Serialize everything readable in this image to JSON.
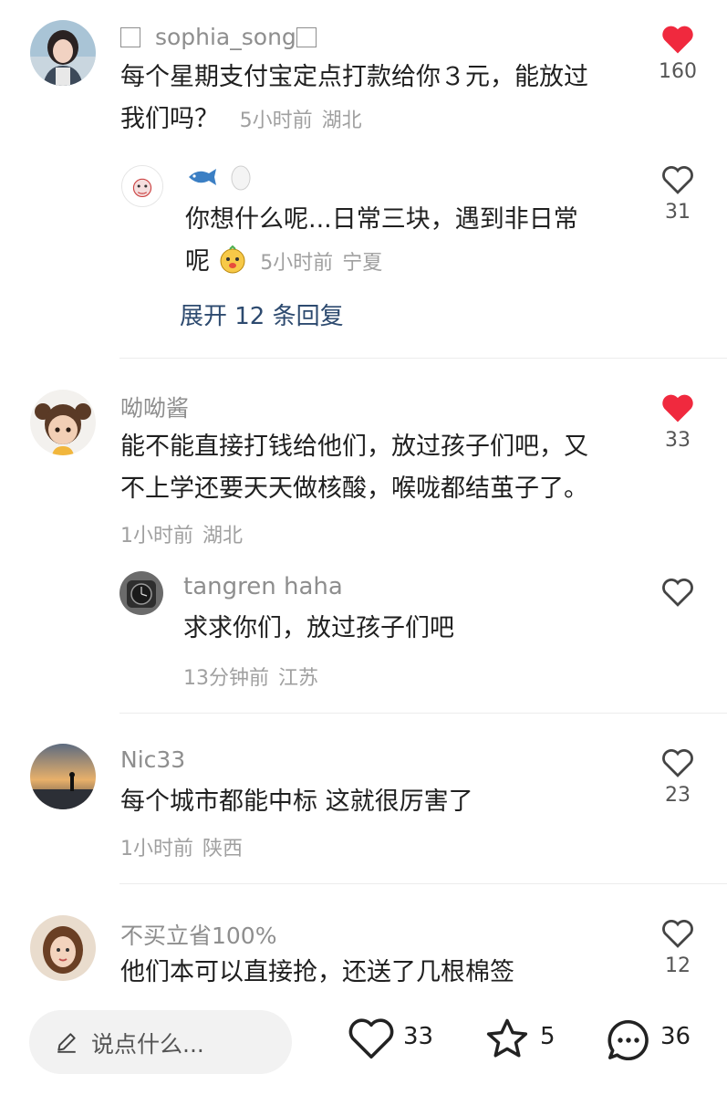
{
  "comments": [
    {
      "username": "sophia_song",
      "text_line1": "每个星期支付宝定点打款给你３元，能放过",
      "text_line2": "我们吗？",
      "time": "5小时前",
      "location": "湖北",
      "likes": "160",
      "liked": true,
      "reply": {
        "username": "🐟🥚",
        "text_line1": "你想什么呢...日常三块，遇到非日常",
        "text_line2": "呢",
        "time": "5小时前",
        "location": "宁夏",
        "likes": "31"
      },
      "expand_label": "展开 12 条回复"
    },
    {
      "username": "呦呦酱",
      "text_line1": "能不能直接打钱给他们，放过孩子们吧，又",
      "text_line2": "不上学还要天天做核酸，喉咙都结茧子了。",
      "time": "1小时前",
      "location": "湖北",
      "likes": "33",
      "liked": true,
      "reply": {
        "username": "tangren haha",
        "text": "求求你们，放过孩子们吧",
        "time": "13分钟前",
        "location": "江苏"
      }
    },
    {
      "username": "Nic33",
      "text": "每个城市都能中标 这就很厉害了",
      "time": "1小时前",
      "location": "陕西",
      "likes": "23"
    },
    {
      "username": "不买立省100%",
      "text": "他们本可以直接抢，还送了几根棉签",
      "likes": "12"
    }
  ],
  "bottom_bar": {
    "input_placeholder": "说点什么...",
    "likes": "33",
    "stars": "5",
    "comments": "36"
  },
  "colors": {
    "liked_heart": "#f0293e",
    "expand_link": "#2d4a6f",
    "meta_text": "#a0a0a0"
  }
}
